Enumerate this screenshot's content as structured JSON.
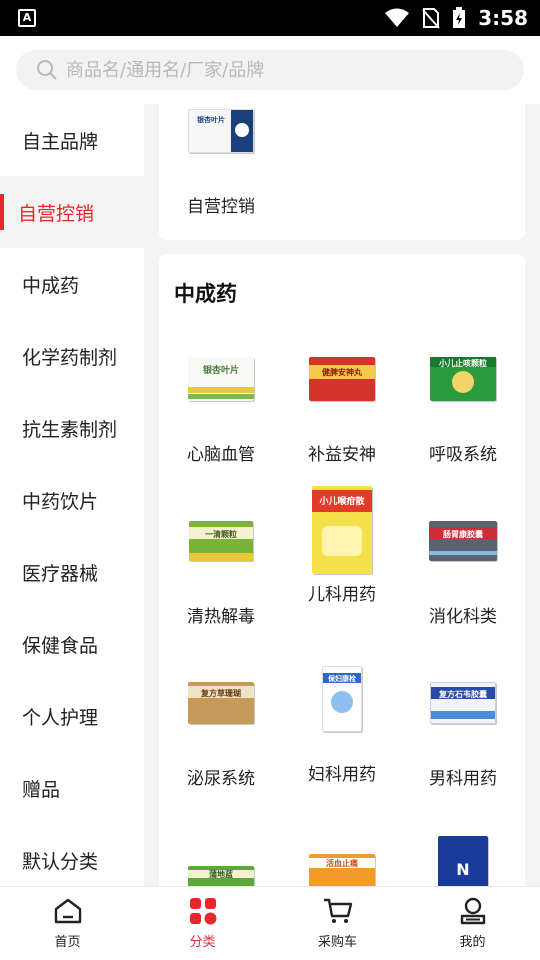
{
  "status_bar": {
    "time": "3:58",
    "app_badge": "A"
  },
  "search": {
    "placeholder": "商品名/通用名/厂家/品牌"
  },
  "sidebar": {
    "items": [
      {
        "label": "自主品牌",
        "active": false
      },
      {
        "label": "自营控销",
        "active": true
      },
      {
        "label": "中成药",
        "active": false
      },
      {
        "label": "化学药制剂",
        "active": false
      },
      {
        "label": "抗生素制剂",
        "active": false
      },
      {
        "label": "中药饮片",
        "active": false
      },
      {
        "label": "医疗器械",
        "active": false
      },
      {
        "label": "保健食品",
        "active": false
      },
      {
        "label": "个人护理",
        "active": false
      },
      {
        "label": "赠品",
        "active": false
      },
      {
        "label": "默认分类",
        "active": false
      }
    ]
  },
  "top_card": {
    "item_label": "自营控销",
    "box_text": "银杏叶片"
  },
  "section": {
    "title": "中成药",
    "items": [
      {
        "label": "心脑血管",
        "box_text": "银杏叶片"
      },
      {
        "label": "补益安神",
        "box_text": "健脾安神丸"
      },
      {
        "label": "呼吸系统",
        "box_text": "小儿止咳颗粒"
      },
      {
        "label": "清热解毒",
        "box_text": "一清颗粒"
      },
      {
        "label": "儿科用药",
        "box_text": "小儿喉疳散"
      },
      {
        "label": "消化科类",
        "box_text": "肠胃康胶囊"
      },
      {
        "label": "泌尿系统",
        "box_text": "复方草珊瑚"
      },
      {
        "label": "妇科用药",
        "box_text": "保妇康栓"
      },
      {
        "label": "男科用药",
        "box_text": "复方石韦胶囊"
      },
      {
        "label": "",
        "box_text": "蒲地蓝"
      },
      {
        "label": "",
        "box_text": "活血止痛"
      },
      {
        "label": "",
        "box_text": "N"
      }
    ]
  },
  "tabbar": {
    "tabs": [
      {
        "label": "首页",
        "active": false
      },
      {
        "label": "分类",
        "active": true
      },
      {
        "label": "采购车",
        "active": false
      },
      {
        "label": "我的",
        "active": false
      }
    ]
  },
  "colors": {
    "accent": "#e8272d",
    "background": "#f4f4f4",
    "surface": "#ffffff"
  }
}
